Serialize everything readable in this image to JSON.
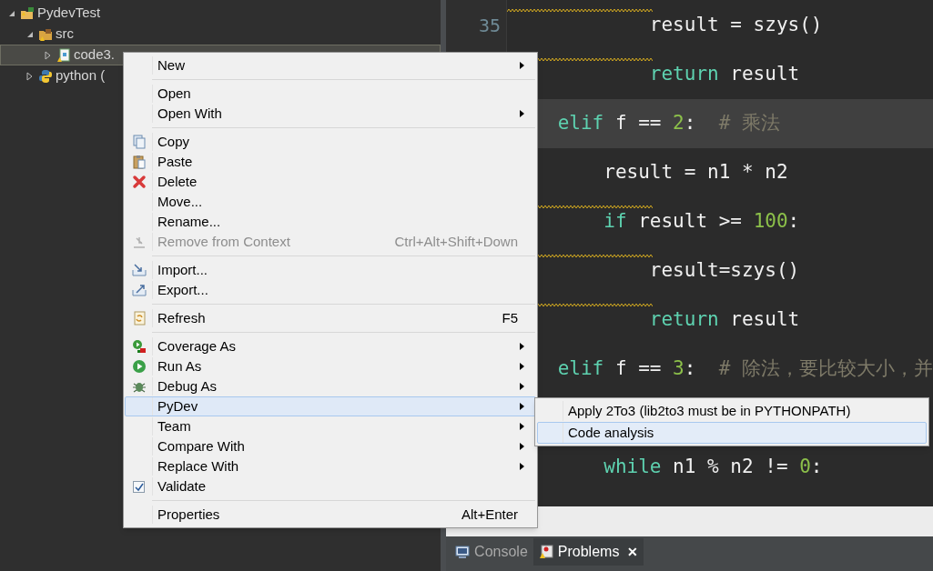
{
  "tree": [
    {
      "label": "PydevTest",
      "expanded": true,
      "selected": false,
      "children": [
        {
          "label": "src",
          "expanded": true,
          "selected": false,
          "children": [
            {
              "label": "code3.",
              "expanded": false,
              "selected": true
            }
          ]
        },
        {
          "label": "python (",
          "expanded": false,
          "selected": false
        }
      ]
    }
  ],
  "editor": {
    "lines": [
      {
        "number": "35",
        "current": false,
        "squiggle": true,
        "tokens": [
          {
            "t": "            result = szys()",
            "kind": "plain"
          }
        ]
      },
      {
        "current": false,
        "squiggle": true,
        "tokens": [
          {
            "t": "            return",
            "kind": "keyword"
          },
          {
            "t": " result",
            "kind": "plain"
          }
        ]
      },
      {
        "current": true,
        "squiggle": false,
        "tokens": [
          {
            "t": "    elif",
            "kind": "keyword"
          },
          {
            "t": " f == ",
            "kind": "plain"
          },
          {
            "t": "2",
            "kind": "number"
          },
          {
            "t": ":  ",
            "kind": "plain"
          },
          {
            "t": "# 乘法",
            "kind": "comment"
          }
        ]
      },
      {
        "current": false,
        "squiggle": false,
        "tokens": [
          {
            "t": "        result = n1 * n2",
            "kind": "plain"
          }
        ]
      },
      {
        "current": false,
        "squiggle": true,
        "tokens": [
          {
            "t": "        if",
            "kind": "keyword"
          },
          {
            "t": " result >= ",
            "kind": "plain"
          },
          {
            "t": "100",
            "kind": "number"
          },
          {
            "t": ":",
            "kind": "plain"
          }
        ]
      },
      {
        "current": false,
        "squiggle": true,
        "tokens": [
          {
            "t": "            result=szys()",
            "kind": "plain"
          }
        ]
      },
      {
        "current": false,
        "squiggle": true,
        "tokens": [
          {
            "t": "            return",
            "kind": "keyword"
          },
          {
            "t": " result",
            "kind": "plain"
          }
        ]
      },
      {
        "current": false,
        "squiggle": false,
        "tokens": [
          {
            "t": "    elif",
            "kind": "keyword"
          },
          {
            "t": " f == ",
            "kind": "plain"
          },
          {
            "t": "3",
            "kind": "number"
          },
          {
            "t": ":  ",
            "kind": "plain"
          },
          {
            "t": "# 除法，要比较大小，并",
            "kind": "comment"
          }
        ]
      },
      {
        "current": false
      },
      {
        "current": false,
        "squiggle": false,
        "tokens": [
          {
            "t": "        while",
            "kind": "keyword"
          },
          {
            "t": " n1 % n2 != ",
            "kind": "plain"
          },
          {
            "t": "0",
            "kind": "number"
          },
          {
            "t": ":",
            "kind": "plain"
          }
        ]
      }
    ]
  },
  "bottom_tabs": [
    {
      "label": "Console",
      "selected": false
    },
    {
      "label": "Problems",
      "selected": true,
      "close": "✕"
    }
  ],
  "context_menu": {
    "items": [
      {
        "kind": "item",
        "label": "New",
        "submenu": true,
        "disabled": false,
        "selected": false
      },
      {
        "kind": "separator"
      },
      {
        "kind": "item",
        "label": "Open",
        "submenu": false,
        "disabled": false,
        "selected": false
      },
      {
        "kind": "item",
        "label": "Open With",
        "submenu": true,
        "disabled": false,
        "selected": false
      },
      {
        "kind": "separator"
      },
      {
        "kind": "item",
        "label": "Copy",
        "submenu": false,
        "disabled": false,
        "selected": false
      },
      {
        "kind": "item",
        "label": "Paste",
        "submenu": false,
        "disabled": false,
        "selected": false
      },
      {
        "kind": "item",
        "label": "Delete",
        "submenu": false,
        "disabled": false,
        "selected": false
      },
      {
        "kind": "item",
        "label": "Move...",
        "submenu": false,
        "disabled": false,
        "selected": false
      },
      {
        "kind": "item",
        "label": "Rename...",
        "submenu": false,
        "disabled": false,
        "selected": false
      },
      {
        "kind": "item",
        "label": "Remove from Context",
        "shortcut": "Ctrl+Alt+Shift+Down",
        "submenu": false,
        "disabled": true,
        "selected": false
      },
      {
        "kind": "separator"
      },
      {
        "kind": "item",
        "label": "Import...",
        "submenu": false,
        "disabled": false,
        "selected": false
      },
      {
        "kind": "item",
        "label": "Export...",
        "submenu": false,
        "disabled": false,
        "selected": false
      },
      {
        "kind": "separator"
      },
      {
        "kind": "item",
        "label": "Refresh",
        "shortcut": "F5",
        "submenu": false,
        "disabled": false,
        "selected": false
      },
      {
        "kind": "separator"
      },
      {
        "kind": "item",
        "label": "Coverage As",
        "submenu": true,
        "disabled": false,
        "selected": false
      },
      {
        "kind": "item",
        "label": "Run As",
        "submenu": true,
        "disabled": false,
        "selected": false
      },
      {
        "kind": "item",
        "label": "Debug As",
        "submenu": true,
        "disabled": false,
        "selected": false
      },
      {
        "kind": "item",
        "label": "PyDev",
        "submenu": true,
        "disabled": false,
        "selected": true
      },
      {
        "kind": "item",
        "label": "Team",
        "submenu": true,
        "disabled": false,
        "selected": false
      },
      {
        "kind": "item",
        "label": "Compare With",
        "submenu": true,
        "disabled": false,
        "selected": false
      },
      {
        "kind": "item",
        "label": "Replace With",
        "submenu": true,
        "disabled": false,
        "selected": false
      },
      {
        "kind": "check",
        "label": "Validate",
        "checked": true,
        "submenu": false,
        "disabled": false,
        "selected": false
      },
      {
        "kind": "separator"
      },
      {
        "kind": "item",
        "label": "Properties",
        "shortcut": "Alt+Enter",
        "submenu": false,
        "disabled": false,
        "selected": false
      }
    ]
  },
  "submenu": {
    "items": [
      {
        "label": "Apply 2To3 (lib2to3 must be in PYTHONPATH)",
        "selected": false
      },
      {
        "label": "Code analysis",
        "selected": true
      }
    ]
  }
}
